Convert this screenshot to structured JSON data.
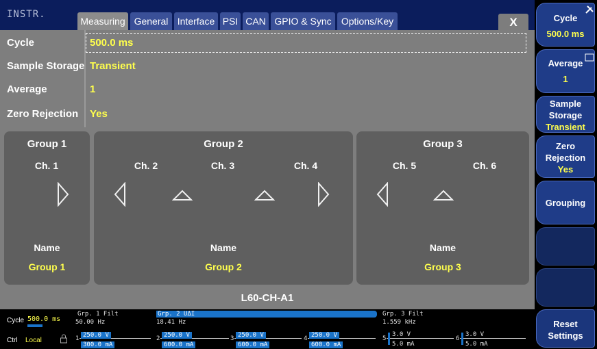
{
  "header": {
    "instr": "INSTR.",
    "tabs": [
      "Measuring",
      "General",
      "Interface",
      "PSI",
      "CAN",
      "GPIO & Sync",
      "Options/Key"
    ],
    "close": "X"
  },
  "settings": [
    {
      "label": "Cycle",
      "value": "500.0 ms"
    },
    {
      "label": "Sample Storage",
      "value": "Transient"
    },
    {
      "label": "Average",
      "value": "1"
    },
    {
      "label": "Zero Rejection",
      "value": "Yes"
    }
  ],
  "groups": [
    {
      "title": "Group 1",
      "channels": [
        "Ch. 1"
      ],
      "name_label": "Name",
      "name": "Group 1"
    },
    {
      "title": "Group 2",
      "channels": [
        "Ch. 2",
        "Ch. 3",
        "Ch. 4"
      ],
      "name_label": "Name",
      "name": "Group 2"
    },
    {
      "title": "Group 3",
      "channels": [
        "Ch. 5",
        "Ch. 6"
      ],
      "name_label": "Name",
      "name": "Group 3"
    }
  ],
  "device": "L60-CH-A1",
  "side": [
    {
      "line1": "Cycle",
      "value": "500.0 ms"
    },
    {
      "line1": "Average",
      "value": "1"
    },
    {
      "line1": "Sample",
      "line2": "Storage",
      "value": "Transient"
    },
    {
      "line1": "Zero",
      "line2": "Rejection",
      "value": "Yes"
    },
    {
      "line1": "Grouping"
    },
    {
      "line1": "Reset",
      "line2": "Settings"
    }
  ],
  "status": {
    "cycle_label": "Cycle",
    "cycle_value": "500.0 ms",
    "ctrl_label": "Ctrl",
    "ctrl_value": "Local",
    "groups": [
      {
        "head": "Grp. 1 Filt",
        "freq": "50.00  Hz"
      },
      {
        "head": "Grp. 2 UΔI",
        "freq": "18.41  Hz"
      },
      {
        "head": "Grp. 3 Filt",
        "freq": "1.559 kHz"
      }
    ],
    "channels": [
      {
        "num": "1",
        "v": "250.0 V",
        "i": "300.0 mA"
      },
      {
        "num": "2",
        "v": "250.0 V",
        "i": "600.0 mA"
      },
      {
        "num": "3",
        "v": "250.0 V",
        "i": "600.0 mA"
      },
      {
        "num": "4",
        "v": "250.0 V",
        "i": "600.0 mA"
      },
      {
        "num": "5",
        "v": "3.0 V",
        "i": "5.0 mA"
      },
      {
        "num": "6",
        "v": "3.0 V",
        "i": "5.0 mA"
      }
    ]
  },
  "colors": {
    "accent_yellow": "#ffff4d",
    "tab_blue": "#3a5098",
    "bar_blue": "#1a73c9"
  }
}
